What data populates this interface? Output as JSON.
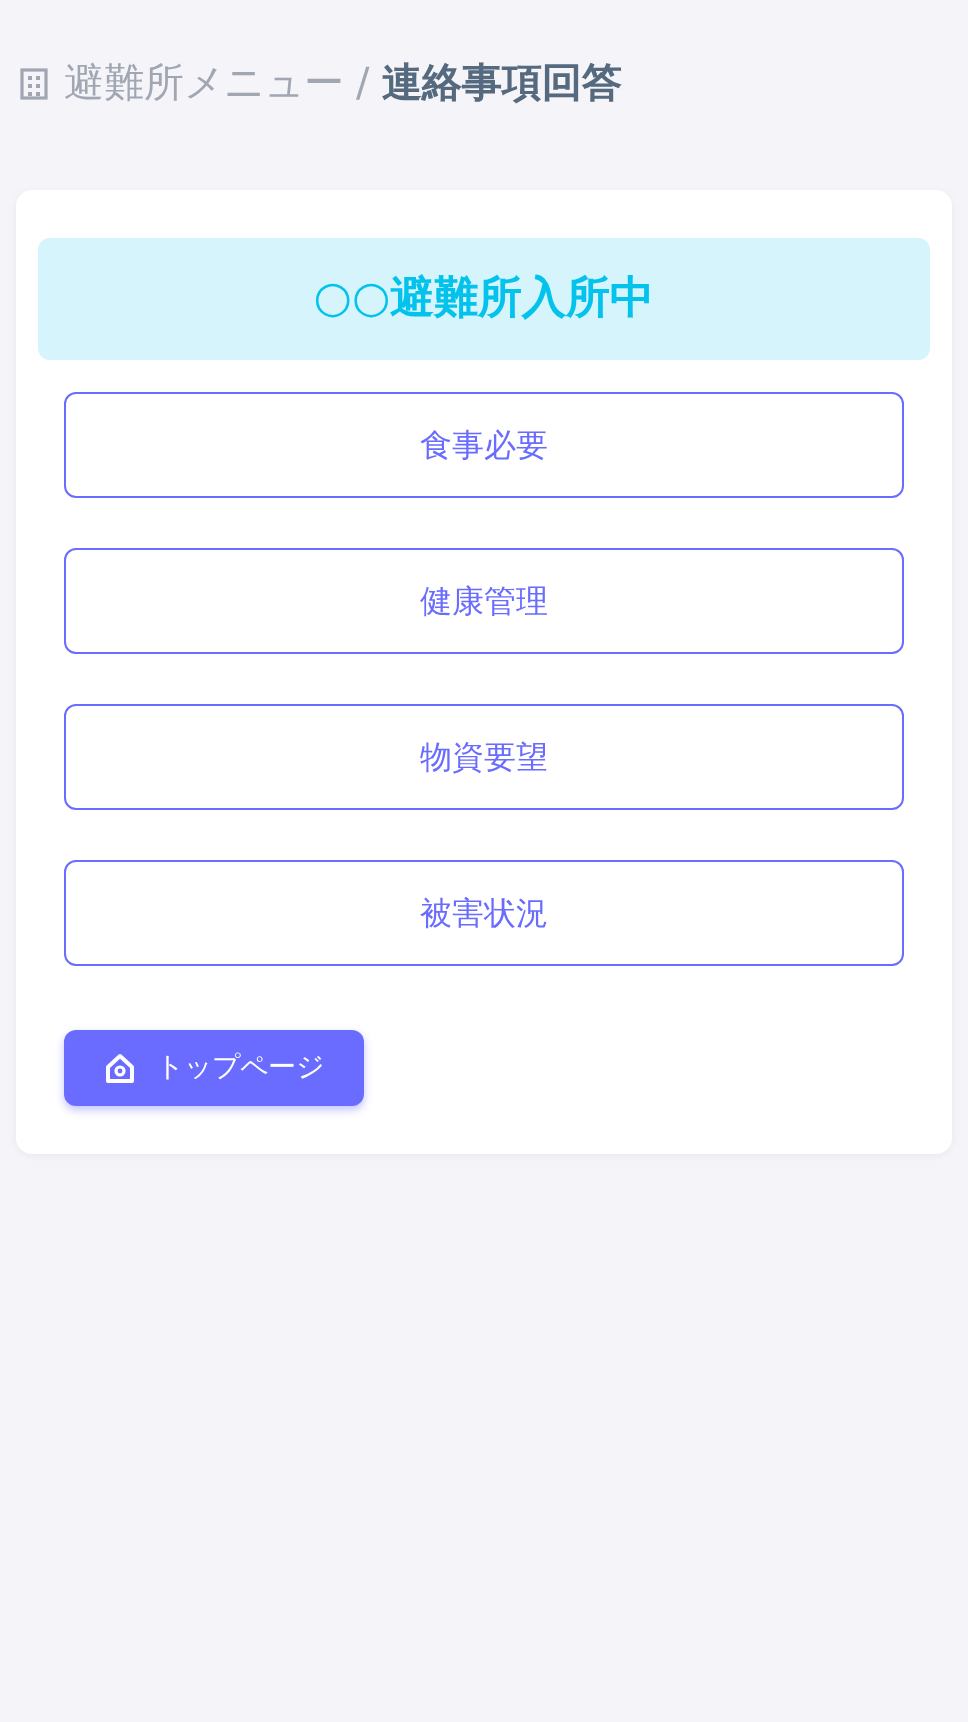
{
  "breadcrumb": {
    "parent": "避難所メニュー",
    "separator": "/",
    "current": "連絡事項回答"
  },
  "status_banner": "○○避難所入所中",
  "menu_buttons": [
    "食事必要",
    "健康管理",
    "物資要望",
    "被害状況"
  ],
  "top_button": "トップページ"
}
